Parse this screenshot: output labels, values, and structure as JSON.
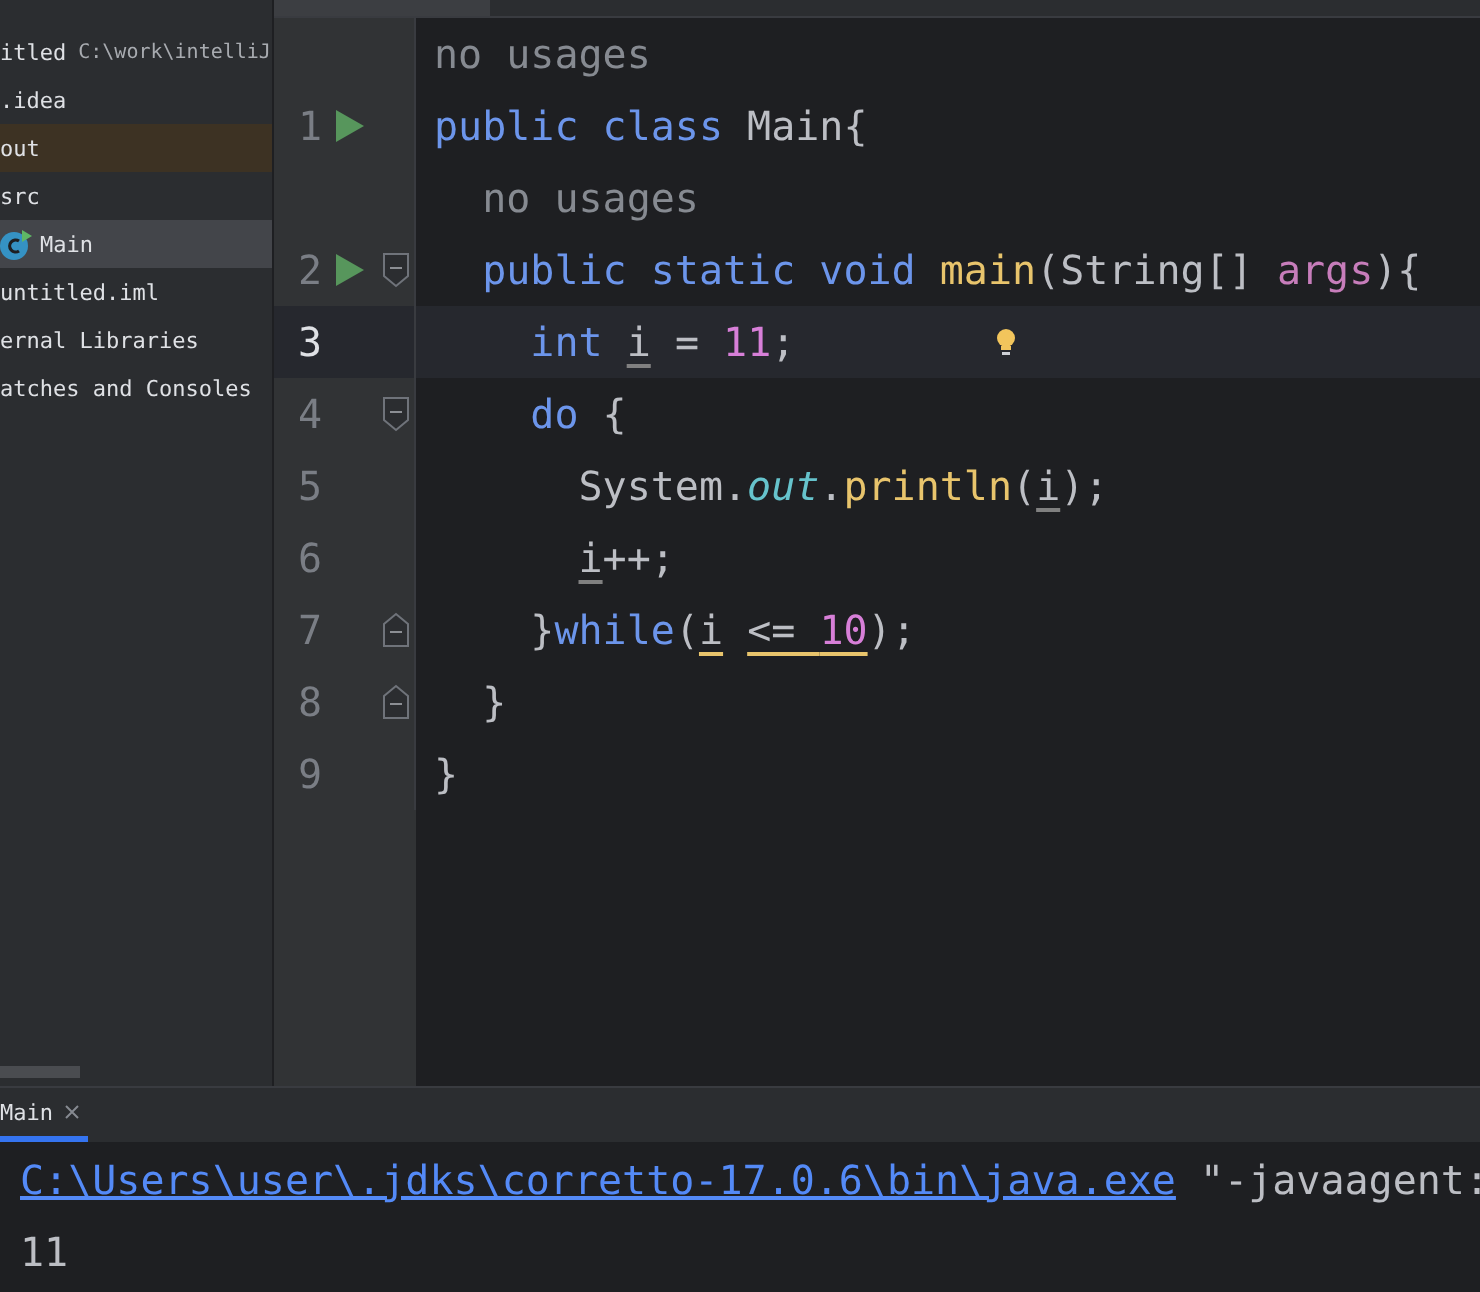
{
  "project_tree": {
    "root": {
      "name": "itled",
      "path": "C:\\work\\intelliJ"
    },
    "items": [
      {
        "label": ".idea",
        "selected": false,
        "highlighted": false
      },
      {
        "label": "out",
        "selected": false,
        "highlighted": true
      },
      {
        "label": "src",
        "selected": false,
        "highlighted": false
      },
      {
        "label": "Main",
        "selected": true,
        "highlighted": false,
        "kind": "class"
      },
      {
        "label": "untitled.iml",
        "selected": false,
        "highlighted": false
      },
      {
        "label": "ernal Libraries",
        "selected": false,
        "highlighted": false
      },
      {
        "label": "atches and Consoles",
        "selected": false,
        "highlighted": false
      }
    ]
  },
  "editor": {
    "rows": [
      {
        "kind": "hint",
        "text": "no usages"
      },
      {
        "kind": "code",
        "number": "1",
        "run": true,
        "fold_open": false,
        "fold_close": false,
        "current": false,
        "bulb": false,
        "tokens": [
          {
            "text": "public class ",
            "kind": "keyword",
            "warning": false
          },
          {
            "text": "Main{",
            "kind": "plain",
            "warning": false
          }
        ]
      },
      {
        "kind": "hint",
        "text": "  no usages"
      },
      {
        "kind": "code",
        "number": "2",
        "run": true,
        "fold_open": true,
        "fold_close": false,
        "current": false,
        "bulb": false,
        "tokens": [
          {
            "text": "  public static void ",
            "kind": "keyword",
            "warning": false
          },
          {
            "text": "main",
            "kind": "method",
            "warning": false
          },
          {
            "text": "(String[] ",
            "kind": "plain",
            "warning": false
          },
          {
            "text": "args",
            "kind": "param",
            "warning": false
          },
          {
            "text": "){",
            "kind": "plain",
            "warning": false
          }
        ]
      },
      {
        "kind": "code",
        "number": "3",
        "run": false,
        "fold_open": false,
        "fold_close": false,
        "current": true,
        "bulb": true,
        "tokens": [
          {
            "text": "    int ",
            "kind": "keyword",
            "warning": false
          },
          {
            "text": "i",
            "kind": "var",
            "warning": false
          },
          {
            "text": " = ",
            "kind": "plain",
            "warning": false
          },
          {
            "text": "11",
            "kind": "number",
            "warning": false
          },
          {
            "text": ";",
            "kind": "plain",
            "warning": false
          }
        ]
      },
      {
        "kind": "code",
        "number": "4",
        "run": false,
        "fold_open": true,
        "fold_close": false,
        "current": false,
        "bulb": false,
        "tokens": [
          {
            "text": "    do ",
            "kind": "keyword",
            "warning": false
          },
          {
            "text": "{",
            "kind": "plain",
            "warning": false
          }
        ]
      },
      {
        "kind": "code",
        "number": "5",
        "run": false,
        "fold_open": false,
        "fold_close": false,
        "current": false,
        "bulb": false,
        "tokens": [
          {
            "text": "      System.",
            "kind": "plain",
            "warning": false
          },
          {
            "text": "out",
            "kind": "field",
            "warning": false
          },
          {
            "text": ".",
            "kind": "plain",
            "warning": false
          },
          {
            "text": "println",
            "kind": "method",
            "warning": false
          },
          {
            "text": "(",
            "kind": "plain",
            "warning": false
          },
          {
            "text": "i",
            "kind": "var",
            "warning": false
          },
          {
            "text": ");",
            "kind": "plain",
            "warning": false
          }
        ]
      },
      {
        "kind": "code",
        "number": "6",
        "run": false,
        "fold_open": false,
        "fold_close": false,
        "current": false,
        "bulb": false,
        "tokens": [
          {
            "text": "      i",
            "kind": "var",
            "warning": false
          },
          {
            "text": "++;",
            "kind": "plain",
            "warning": false
          }
        ]
      },
      {
        "kind": "code",
        "number": "7",
        "run": false,
        "fold_open": false,
        "fold_close": true,
        "current": false,
        "bulb": false,
        "tokens": [
          {
            "text": "    }",
            "kind": "plain",
            "warning": false
          },
          {
            "text": "while",
            "kind": "keyword",
            "warning": false
          },
          {
            "text": "(",
            "kind": "plain",
            "warning": false
          },
          {
            "text": "i",
            "kind": "var",
            "warning": true
          },
          {
            "text": " <= ",
            "kind": "plain",
            "warning": true
          },
          {
            "text": "10",
            "kind": "number",
            "warning": true
          },
          {
            "text": ");",
            "kind": "plain",
            "warning": false
          }
        ]
      },
      {
        "kind": "code",
        "number": "8",
        "run": false,
        "fold_open": false,
        "fold_close": true,
        "current": false,
        "bulb": false,
        "tokens": [
          {
            "text": "  }",
            "kind": "plain",
            "warning": false
          }
        ]
      },
      {
        "kind": "code",
        "number": "9",
        "run": false,
        "fold_open": false,
        "fold_close": false,
        "current": false,
        "bulb": false,
        "tokens": [
          {
            "text": "}",
            "kind": "plain",
            "warning": false
          }
        ]
      }
    ]
  },
  "run_panel": {
    "tab": {
      "label": "Main",
      "selected": true
    },
    "output": [
      {
        "kind": "command",
        "link": "C:\\Users\\user\\.jdks\\corretto-17.0.6\\bin\\java.exe",
        "rest": " \"-javaagent:"
      },
      {
        "kind": "text",
        "text": "11"
      }
    ]
  }
}
